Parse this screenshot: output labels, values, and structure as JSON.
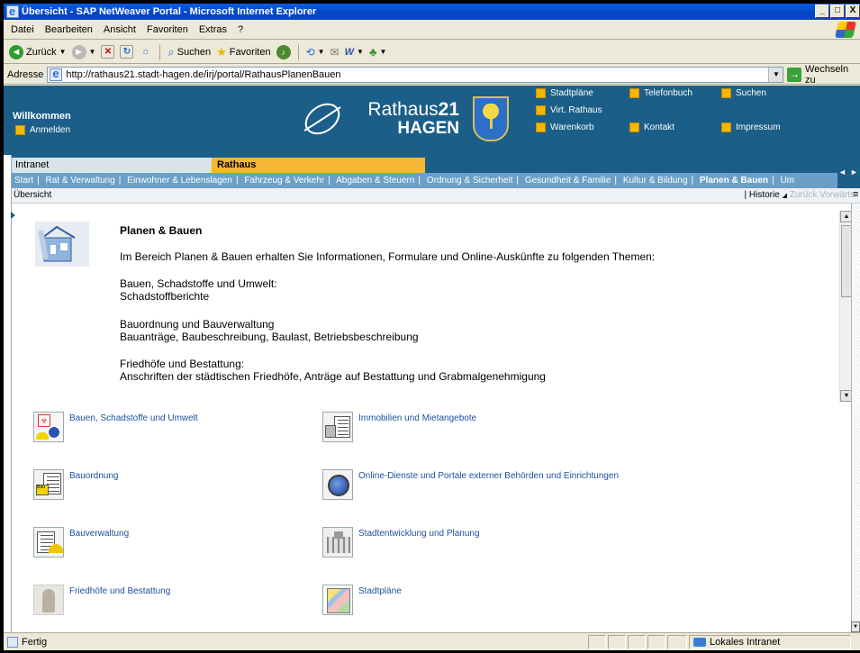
{
  "window": {
    "title": "Übersicht - SAP NetWeaver Portal - Microsoft Internet Explorer",
    "buttons": [
      "_",
      "□",
      "X"
    ]
  },
  "menubar": {
    "items": [
      "Datei",
      "Bearbeiten",
      "Ansicht",
      "Favoriten",
      "Extras",
      "?"
    ]
  },
  "toolbar": {
    "back_label": "Zurück",
    "search_label": "Suchen",
    "favorites_label": "Favoriten"
  },
  "address": {
    "label": "Adresse",
    "url": "http://rathaus21.stadt-hagen.de/irj/portal/RathausPlanenBauen",
    "go_label": "Wechseln zu"
  },
  "header": {
    "welcome": "Willkommen",
    "login": "Anmelden",
    "logo_line1_a": "Rathaus",
    "logo_line1_b": "21",
    "logo_line2": "HAGEN",
    "links_col1": [
      "Stadtpläne",
      "Virt. Rathaus",
      "Warenkorb"
    ],
    "links_col2": [
      "Telefonbuch",
      "Kontakt"
    ],
    "links_col3": [
      "Suchen",
      "Impressum"
    ]
  },
  "nav": {
    "tab_intranet": "Intranet",
    "tab_rathaus": "Rathaus",
    "sub": [
      "Start",
      "Rat & Verwaltung",
      "Einwohner & Lebenslagen",
      "Fahrzeug & Verkehr",
      "Abgaben & Steuern",
      "Ordnung & Sicherheit",
      "Gesundheit & Familie",
      "Kultur & Bildung",
      "Planen & Bauen",
      "Um"
    ]
  },
  "crumb": {
    "current": "Übersicht",
    "historie": "Historie",
    "zurueck": "Zurück",
    "vorwaerts": "Vorwärts"
  },
  "content": {
    "heading": "Planen & Bauen",
    "intro": "Im Bereich Planen & Bauen erhalten Sie Informationen, Formulare und Online-Auskünfte zu folgenden Themen:",
    "blocks": [
      {
        "title": "Bauen, Schadstoffe und Umwelt:",
        "text": "Schadstoffberichte"
      },
      {
        "title": "Bauordnung und Bauverwaltung",
        "text": "Bauanträge, Baubeschreibung, Baulast, Betriebsbeschreibung"
      },
      {
        "title": "Friedhöfe und Bestattung:",
        "text": "Anschriften der städtischen Friedhöfe, Anträge auf Bestattung und Grabmalgenehmigung"
      }
    ]
  },
  "quicklinks": [
    "Bauen, Schadstoffe und Umwelt",
    "Immobilien und Mietangebote",
    "Bauordnung",
    "Online-Dienste und Portale externer Behörden und Einrichtungen",
    "Bauverwaltung",
    "Stadtentwicklung und Planung",
    "Friedhöfe und Bestattung",
    "Stadtpläne"
  ],
  "status": {
    "left": "Fertig",
    "zone": "Lokales Intranet"
  }
}
